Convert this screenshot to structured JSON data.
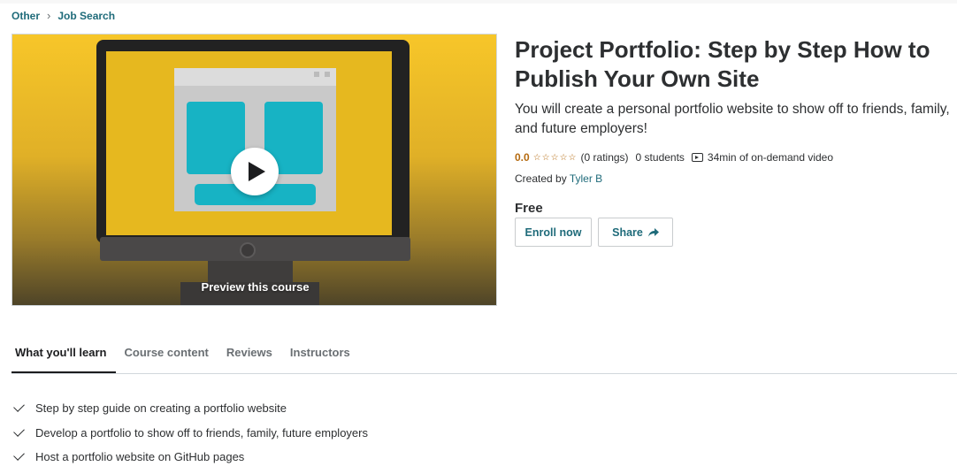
{
  "breadcrumb": {
    "items": [
      {
        "label": "Other"
      },
      {
        "label": "Job Search"
      }
    ],
    "separator": "›"
  },
  "hero": {
    "preview_label": "Preview this course",
    "background_colors": [
      "#f7c629",
      "#4e4428"
    ],
    "illustration_colors": {
      "monitor_frame": "#222222",
      "screen": "#e6b81f",
      "window": "#a6a6a6",
      "tile": "#17b3c4"
    },
    "icons": {
      "play": "play-icon"
    }
  },
  "course": {
    "title": "Project Portfolio: Step by Step How to Publish Your Own Site",
    "subtitle": "You will create a personal portfolio website to show off to friends, family, and future employers!",
    "rating": "0.0",
    "stars": "☆☆☆☆☆",
    "ratings_count": "(0 ratings)",
    "students": "0 students",
    "video_length": "34min of on-demand video",
    "created_by_label": "Created by",
    "instructor": "Tyler B",
    "price": "Free"
  },
  "actions": {
    "enroll_label": "Enroll now",
    "share_label": "Share"
  },
  "tabs": [
    {
      "label": "What you'll learn",
      "active": true
    },
    {
      "label": "Course content",
      "active": false
    },
    {
      "label": "Reviews",
      "active": false
    },
    {
      "label": "Instructors",
      "active": false
    }
  ],
  "learn_items": [
    "Step by step guide on creating a portfolio website",
    "Develop a portfolio to show off to friends, family, future employers",
    "Host a portfolio website on GitHub pages"
  ],
  "colors": {
    "link": "#1f6b7a",
    "rating": "#b4690e",
    "text": "#2d2f31",
    "muted": "#6a6f73"
  }
}
